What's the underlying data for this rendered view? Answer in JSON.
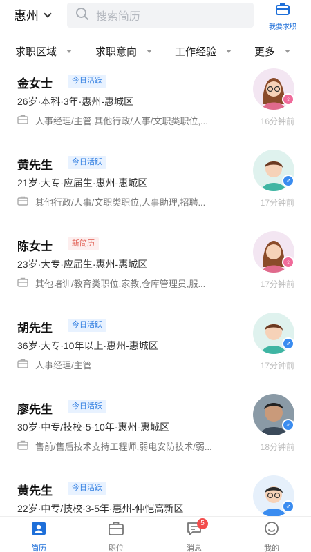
{
  "header": {
    "city": "惠州",
    "search_placeholder": "搜索简历",
    "job_hunt_label": "我要求职"
  },
  "filters": [
    "求职区域",
    "求职意向",
    "工作经验",
    "更多"
  ],
  "resumes": [
    {
      "name": "金女士",
      "tag": "今日活跃",
      "tag_style": "blue",
      "info": "26岁·本科·3年·惠州-惠城区",
      "intent": "人事经理/主管,其他行政/人事/文职类职位,...",
      "time": "16分钟前",
      "gender": "female",
      "gender_symbol": "♀"
    },
    {
      "name": "黄先生",
      "tag": "今日活跃",
      "tag_style": "blue",
      "info": "21岁·大专·应届生·惠州-惠城区",
      "intent": "其他行政/人事/文职类职位,人事助理,招聘...",
      "time": "17分钟前",
      "gender": "male",
      "gender_symbol": "♂"
    },
    {
      "name": "陈女士",
      "tag": "新简历",
      "tag_style": "red",
      "info": "23岁·大专·应届生·惠州-惠城区",
      "intent": "其他培训/教育类职位,家教,仓库管理员,服...",
      "time": "17分钟前",
      "gender": "female",
      "gender_symbol": "♀"
    },
    {
      "name": "胡先生",
      "tag": "今日活跃",
      "tag_style": "blue",
      "info": "36岁·大专·10年以上·惠州-惠城区",
      "intent": "人事经理/主管",
      "time": "17分钟前",
      "gender": "male",
      "gender_symbol": "♂"
    },
    {
      "name": "廖先生",
      "tag": "今日活跃",
      "tag_style": "blue",
      "info": "30岁·中专/技校·5-10年·惠州-惠城区",
      "intent": "售前/售后技术支持工程师,弱电安防技术/弱...",
      "time": "18分钟前",
      "gender": "male",
      "gender_symbol": "♂"
    },
    {
      "name": "黄先生",
      "tag": "今日活跃",
      "tag_style": "blue",
      "info": "22岁·中专/技校·3-5年·惠州-仲恺高新区",
      "intent": "",
      "time": "",
      "gender": "male",
      "gender_symbol": "♂"
    }
  ],
  "bottom_nav": [
    {
      "label": "简历",
      "icon": "resume-icon",
      "active": true
    },
    {
      "label": "职位",
      "icon": "briefcase-icon",
      "active": false
    },
    {
      "label": "消息",
      "icon": "message-icon",
      "active": false,
      "badge": "5"
    },
    {
      "label": "我的",
      "icon": "profile-icon",
      "active": false
    }
  ],
  "colors": {
    "accent": "#1e6fd9",
    "active_tag_bg": "#e8f2ff",
    "new_tag_fg": "#e05a4f"
  }
}
